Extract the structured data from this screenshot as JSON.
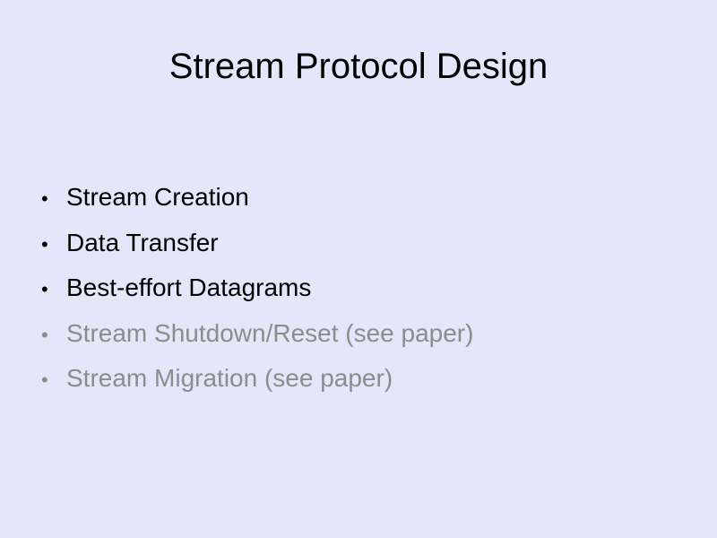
{
  "slide": {
    "title": "Stream Protocol Design",
    "bullet_glyph": "•",
    "bullets": [
      {
        "text": "Stream Creation",
        "state": "active"
      },
      {
        "text": "Data Transfer",
        "state": "active"
      },
      {
        "text": "Best-effort Datagrams",
        "state": "active"
      },
      {
        "text": "Stream Shutdown/Reset (see paper)",
        "state": "dimmed"
      },
      {
        "text": "Stream Migration (see paper)",
        "state": "dimmed"
      }
    ]
  },
  "colors": {
    "background": "#e6e6fa",
    "text": "#000000",
    "dimmed_text": "#8c8c8c"
  }
}
